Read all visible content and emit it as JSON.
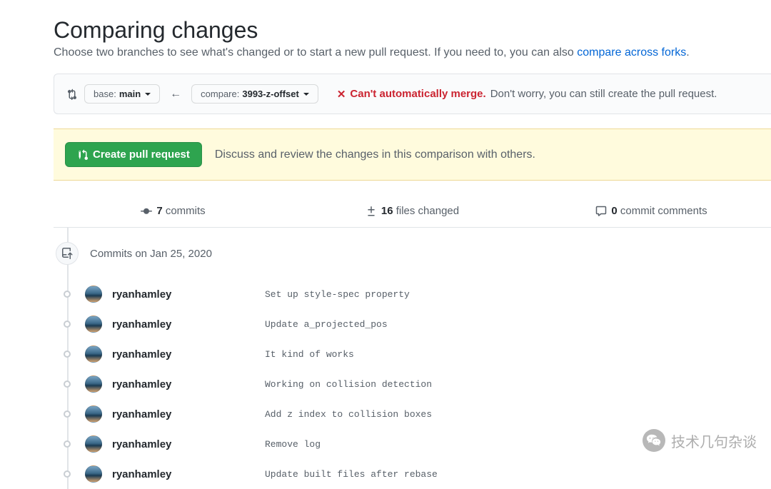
{
  "header": {
    "title": "Comparing changes",
    "subtitle_pre": "Choose two branches to see what's changed or to start a new pull request. If you need to, you can also ",
    "subtitle_link": "compare across forks",
    "subtitle_post": "."
  },
  "compare": {
    "base_label": "base: ",
    "base_value": "main",
    "compare_label": "compare: ",
    "compare_value": "3993-z-offset",
    "merge_cant": "Can't automatically merge.",
    "merge_rest": "Don't worry, you can still create the pull request."
  },
  "pr": {
    "button": "Create pull request",
    "desc": "Discuss and review the changes in this comparison with others."
  },
  "stats": {
    "commits_num": "7",
    "commits_label": " commits",
    "files_num": "16",
    "files_label": " files changed",
    "comments_num": "0",
    "comments_label": " commit comments"
  },
  "commits": {
    "date_label": "Commits on Jan 25, 2020",
    "items": [
      {
        "author": "ryanhamley",
        "msg": "Set up style-spec property"
      },
      {
        "author": "ryanhamley",
        "msg": "Update a_projected_pos"
      },
      {
        "author": "ryanhamley",
        "msg": "It kind of works"
      },
      {
        "author": "ryanhamley",
        "msg": "Working on collision detection"
      },
      {
        "author": "ryanhamley",
        "msg": "Add z index to collision boxes"
      },
      {
        "author": "ryanhamley",
        "msg": "Remove log"
      },
      {
        "author": "ryanhamley",
        "msg": "Update built files after rebase"
      }
    ]
  },
  "watermark": {
    "text": "技术几句杂谈"
  }
}
